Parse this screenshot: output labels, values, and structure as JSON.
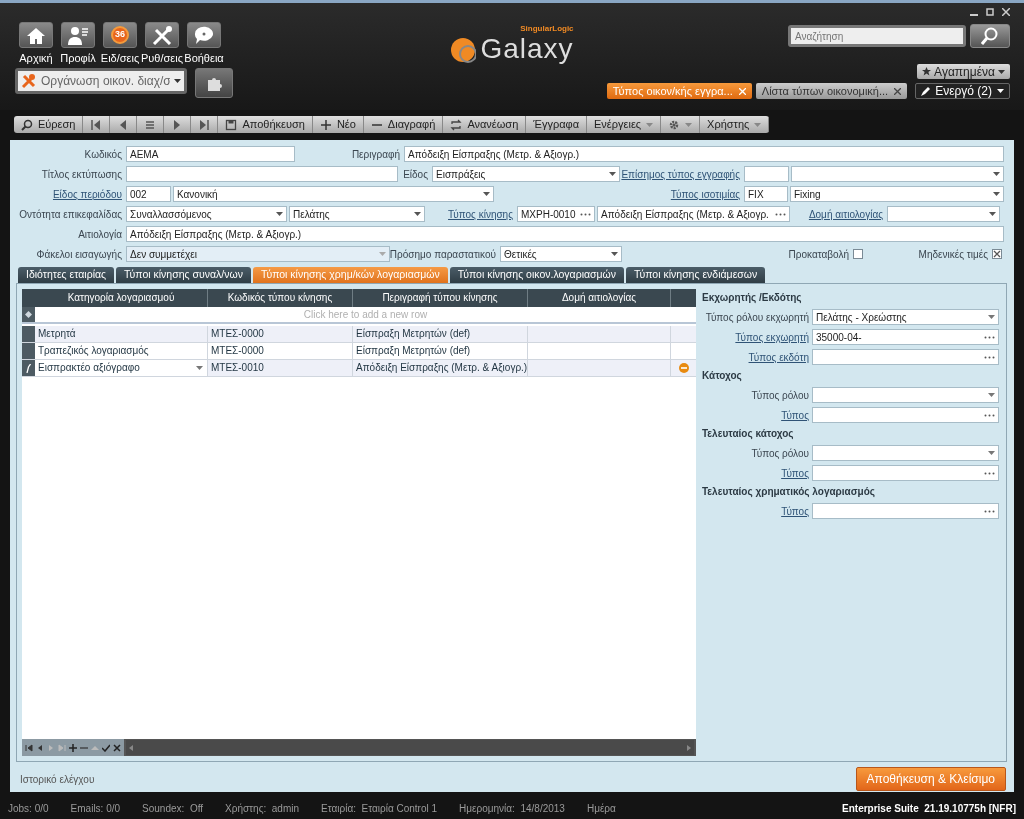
{
  "top_nav": [
    {
      "label": "Αρχική"
    },
    {
      "label": "Προφίλ"
    },
    {
      "label": "Ειδ/σεις",
      "badge": "36"
    },
    {
      "label": "Ρυθ/σεις"
    },
    {
      "label": "Βοήθεια"
    }
  ],
  "module_select": {
    "value": "Οργάνωση οικον. διαχ/σ"
  },
  "logo": {
    "brand": "SingularLogic",
    "product": "Galaxy"
  },
  "search": {
    "placeholder": "Αναζήτηση"
  },
  "favorites": {
    "label": "Αγαπημένα"
  },
  "doc_tabs": [
    {
      "label": "Τύπος οικον/κής εγγρα...",
      "selected": true
    },
    {
      "label": "Λίστα τύπων οικονομική...",
      "selected": false
    }
  ],
  "active_windows": {
    "label": "Ενεργό (2)"
  },
  "toolbar": [
    {
      "kind": "button",
      "label": "Εύρεση"
    },
    {
      "kind": "icon"
    },
    {
      "kind": "icon"
    },
    {
      "kind": "icon"
    },
    {
      "kind": "icon"
    },
    {
      "kind": "icon"
    },
    {
      "kind": "button",
      "label": "Αποθήκευση"
    },
    {
      "kind": "button",
      "label": "Νέο"
    },
    {
      "kind": "button",
      "label": "Διαγραφή"
    },
    {
      "kind": "button",
      "label": "Ανανέωση"
    },
    {
      "kind": "button",
      "label": "Έγγραφα"
    },
    {
      "kind": "menu",
      "label": "Ενέργειες"
    },
    {
      "kind": "icon-menu"
    },
    {
      "kind": "menu",
      "label": "Χρήστης"
    }
  ],
  "form": {
    "lines": [
      {
        "fields": [
          {
            "label": "Κωδικός",
            "link": false,
            "controls": [
              {
                "kind": "input",
                "value": "ΑΕΜΑ"
              }
            ]
          },
          {
            "label": "Περιγραφή",
            "link": false,
            "controls": [
              {
                "kind": "input",
                "value": "Απόδειξη Είσπραξης (Μετρ. & Αξιογρ.)"
              }
            ]
          }
        ]
      },
      {
        "fields": [
          {
            "label": "Τίτλος εκτύπωσης",
            "link": false,
            "controls": [
              {
                "kind": "input"
              }
            ]
          },
          {
            "label": "Είδος",
            "link": false,
            "controls": [
              {
                "kind": "select",
                "value": "Εισπράξεις"
              }
            ]
          },
          {
            "label": "Επίσημος τύπος εγγραφής",
            "link": true,
            "controls": [
              {
                "kind": "input"
              },
              {
                "kind": "select"
              }
            ]
          }
        ]
      },
      {
        "fields": [
          {
            "label": "Είδος περιόδου",
            "link": true,
            "controls": [
              {
                "kind": "input",
                "value": "002"
              },
              {
                "kind": "select",
                "value": "Κανονική"
              }
            ]
          },
          {
            "label": "Τύπος ισοτιμίας",
            "link": true,
            "controls": [
              {
                "kind": "input",
                "value": "FIX"
              },
              {
                "kind": "select",
                "value": "Fixing"
              }
            ]
          }
        ]
      },
      {
        "fields": [
          {
            "label": "Οντότητα επικεφαλίδας",
            "link": false,
            "controls": [
              {
                "kind": "select",
                "value": "Συναλλασσόμενος"
              },
              {
                "kind": "select",
                "value": "Πελάτης"
              }
            ]
          },
          {
            "label": "Τύπος κίνησης",
            "link": true,
            "controls": [
              {
                "kind": "lookup",
                "value": "ΜΧΡΗ-0010"
              },
              {
                "kind": "lookup",
                "value": "Απόδειξη Είσπραξης (Μετρ. & Αξιογρ."
              }
            ]
          },
          {
            "label": "Δομή αιτιολογίας",
            "link": true,
            "controls": [
              {
                "kind": "select"
              }
            ]
          }
        ]
      },
      {
        "fields": [
          {
            "label": "Αιτιολογία",
            "link": false,
            "controls": [
              {
                "kind": "input",
                "value": "Απόδειξη Είσπραξης (Μετρ. & Αξιογρ.)"
              }
            ]
          }
        ]
      },
      {
        "fields": [
          {
            "label": "Φάκελοι εισαγωγής",
            "link": false,
            "controls": [
              {
                "kind": "select",
                "value": "Δεν συμμετέχει",
                "disabled": true
              }
            ]
          },
          {
            "label": "Πρόσημο παραστατικού",
            "link": false,
            "controls": [
              {
                "kind": "select",
                "value": "Θετικές"
              }
            ]
          },
          {
            "label": "Προκαταβολή",
            "link": false,
            "controls": [
              {
                "kind": "checkbox",
                "checked": false
              }
            ]
          },
          {
            "label": "Μηδενικές τιμές",
            "link": false,
            "controls": [
              {
                "kind": "checkbox",
                "checked": true
              }
            ]
          }
        ]
      }
    ]
  },
  "tabs": [
    {
      "label": "Ιδιότητες εταιρίας",
      "selected": false
    },
    {
      "label": "Τύποι κίνησης συναλ/νων",
      "selected": false
    },
    {
      "label": "Τύποι κίνησης χρημ/κών λογαριασμών",
      "selected": true
    },
    {
      "label": "Τύποι κίνησης οικον.λογαριασμών",
      "selected": false
    },
    {
      "label": "Τύποι κίνησης ενδιάμεσων",
      "selected": false
    }
  ],
  "grid": {
    "columns": [
      "Κατηγορία λογαριασμού",
      "Κωδικός τύπου κίνησης",
      "Περιγραφή τύπου κίνησης",
      "Δομή αιτιολογίας"
    ],
    "new_row_hint": "Click here to add a new row",
    "rows": [
      {
        "cells": [
          "Μετρητά",
          "ΜΤΕΣ-0000",
          "Είσπραξη Μετρητών (def)"
        ],
        "selected": false
      },
      {
        "cells": [
          "Τραπεζικός λογαριασμός",
          "ΜΤΕΣ-0000",
          "Είσπραξη Μετρητών (def)"
        ],
        "selected": false
      },
      {
        "cells": [
          "Εισπρακτέο αξιόγραφο",
          "ΜΤΕΣ-0010",
          "Απόδειξη Είσπραξης (Μετρ. & Αξιογρ.)"
        ],
        "selected": true
      }
    ]
  },
  "side_panel": {
    "sections": [
      {
        "title": "Εκχωρητής /Εκδότης",
        "fields": [
          {
            "label": "Τύπος ρόλου εκχωρητή",
            "link": false,
            "kind": "select",
            "value": "Πελάτης - Χρεώστης"
          },
          {
            "label": "Τύπος εκχωρητή",
            "link": true,
            "kind": "lookup",
            "value": "35000-04-"
          },
          {
            "label": "Τύπος εκδότη",
            "link": true,
            "kind": "lookup"
          }
        ]
      },
      {
        "title": "Κάτοχος",
        "fields": [
          {
            "label": "Τύπος ρόλου",
            "link": false,
            "kind": "select"
          },
          {
            "label": "Τύπος",
            "link": true,
            "kind": "lookup"
          }
        ]
      },
      {
        "title": "Τελευταίος κάτοχος",
        "fields": [
          {
            "label": "Τύπος ρόλου",
            "link": false,
            "kind": "select"
          },
          {
            "label": "Τύπος",
            "link": true,
            "kind": "lookup"
          }
        ]
      },
      {
        "title": "Τελευταίος χρηματικός λογαριασμός",
        "fields": [
          {
            "label": "Τύπος",
            "link": true,
            "kind": "lookup"
          }
        ]
      }
    ]
  },
  "footer": {
    "history_link": "Ιστορικό ελέγχου",
    "save_close": "Αποθήκευση & Κλείσιμο"
  },
  "status_bar": {
    "items": [
      "Jobs: 0/0",
      "Emails: 0/0",
      "Soundex:  Off",
      "Χρήστης:  admin",
      "Εταιρία:  Εταιρία Control 1",
      "Ημερομηνία:  14/8/2013",
      "Ημέρα"
    ],
    "version": "Enterprise Suite  21.19.10775h [NFR]"
  }
}
